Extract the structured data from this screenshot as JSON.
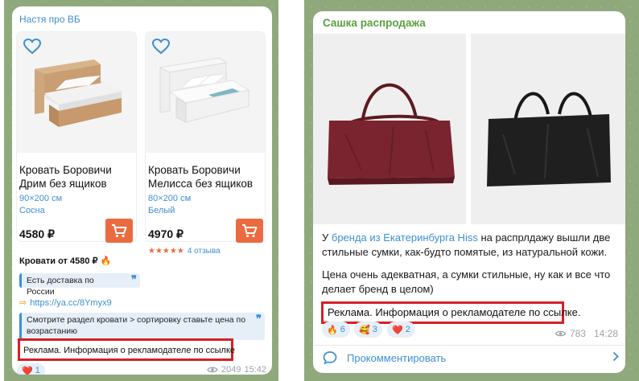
{
  "left_post": {
    "channel": "Настя про ВБ",
    "products": [
      {
        "title": "Кровать Боровичи Дрим без ящиков",
        "size": "90×200 см",
        "color": "Сосна",
        "price": "4580 ₽",
        "rating_stars": "",
        "reviews": ""
      },
      {
        "title": "Кровать Боровичи Мелисса без ящиков",
        "size": "80×200 см",
        "color": "Белый",
        "price": "4970 ₽",
        "rating_stars": "★★★★★",
        "reviews": "4 отзыва"
      }
    ],
    "promo": "Кровати от 4580 ₽ 🔥",
    "quote1": "Есть доставка по России",
    "link": "https://ya.cc/8Ymyx9",
    "quote2": "Смотрите раздел кровати > сортировку ставьте цена по возрастанию",
    "ad": "Реклама. Информация о рекламодателе по ссылке",
    "reaction": {
      "emoji": "❤️",
      "count": "1"
    },
    "views": "2049",
    "time": "15:42"
  },
  "right_post": {
    "channel": "Сашка распродажа",
    "text1_pre": "У ",
    "text1_link": "бренда из Екатеринбурга Hiss",
    "text1_post": " на распрлдажу вышли две стильные сумки, как-будто помятые, из натуральной кожи.",
    "text2": "Цена очень адекватная, а сумки стильные, ну как и все что делает бренд в целом)",
    "ad": "Реклама. Информация о рекламодателе по ссылке.",
    "reactions": [
      {
        "emoji": "🔥",
        "count": "6"
      },
      {
        "emoji": "🥰",
        "count": "3"
      },
      {
        "emoji": "❤️",
        "count": "2"
      }
    ],
    "views": "783",
    "time": "14:28",
    "comment_label": "Прокомментировать"
  },
  "colors": {
    "accent": "#3d8fd4",
    "cart": "#ec6a3f",
    "ad_border": "#d81f26",
    "chat_bg": "#8fa97c",
    "channel_green": "#5a9f3e"
  },
  "icons": [
    "heart-icon",
    "cart-icon",
    "eye-icon",
    "comment-icon",
    "chevron-right-icon",
    "quote-icon",
    "arrow-right-icon"
  ]
}
